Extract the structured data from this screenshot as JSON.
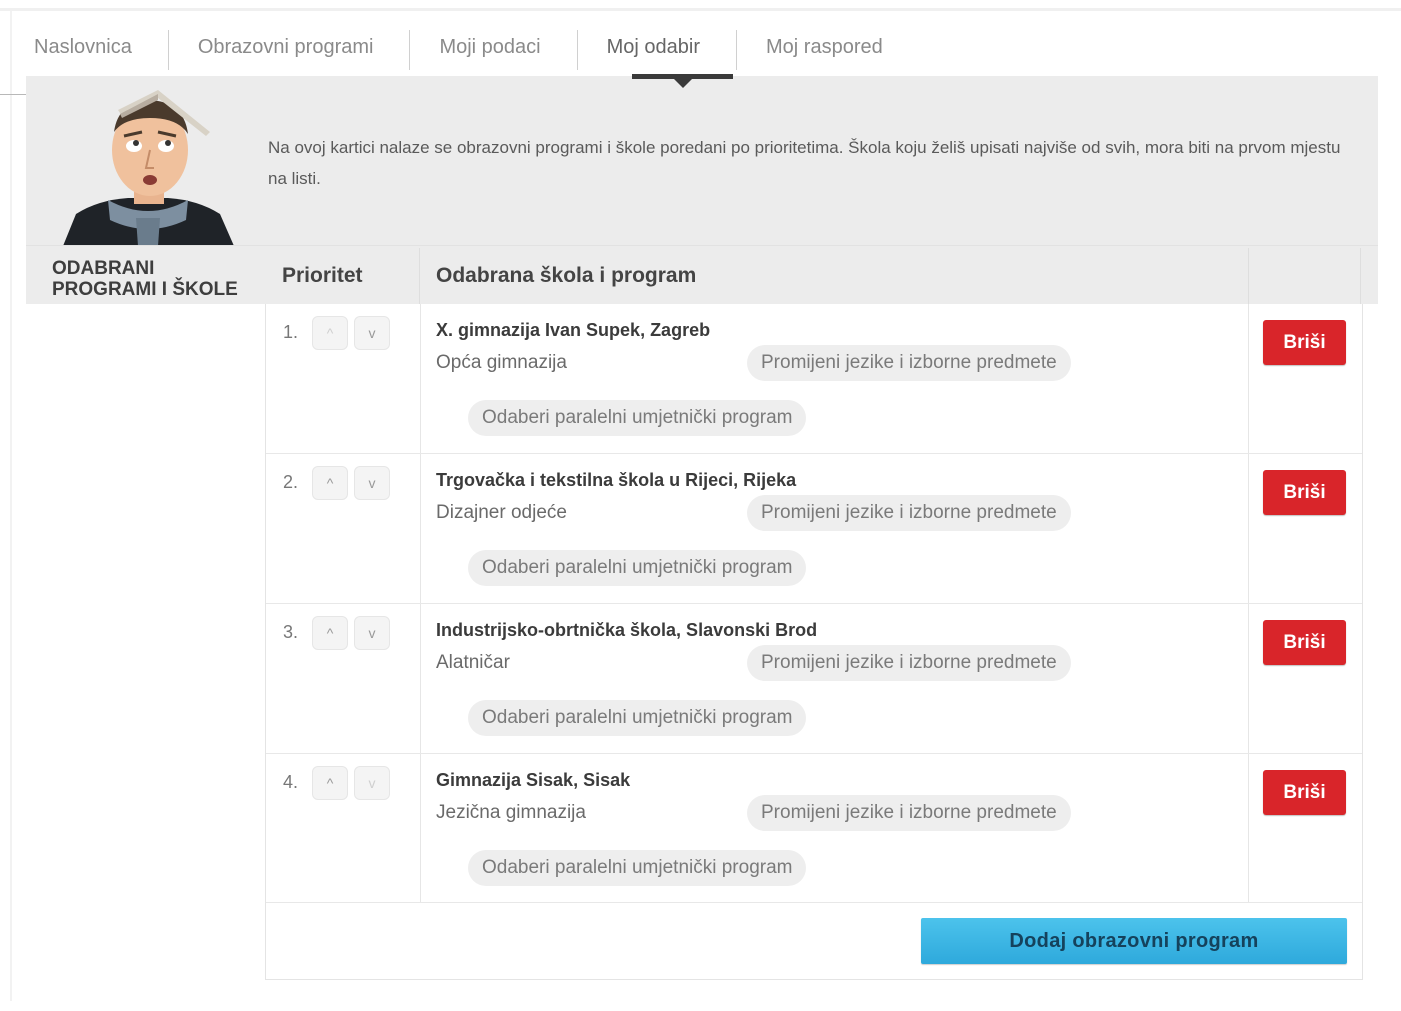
{
  "tabs": [
    {
      "label": "Naslovnica"
    },
    {
      "label": "Obrazovni programi"
    },
    {
      "label": "Moji podaci"
    },
    {
      "label": "Moj odabir"
    },
    {
      "label": "Moj raspored"
    }
  ],
  "active_tab": "Moj odabir",
  "intro_text": "Na ovoj kartici nalaze se obrazovni programi i škole poredani po prioritetima. Škola koju želiš upisati najviše od svih, mora biti na prvom mjestu na listi.",
  "section_title": "ODABRANI PROGRAMI I ŠKOLE",
  "table": {
    "header_priority": "Prioritet",
    "header_program": "Odabrana škola i program",
    "rows": [
      {
        "priority": "1.",
        "school": "X. gimnazija Ivan Supek, Zagreb",
        "program": "Opća gimnazija",
        "lang_button": "Promijeni jezike i izborne predmete",
        "art_button": "Odaberi paralelni umjetnički program",
        "delete_label": "Briši"
      },
      {
        "priority": "2.",
        "school": "Trgovačka i tekstilna škola u Rijeci, Rijeka",
        "program": "Dizajner odjeće",
        "lang_button": "Promijeni jezike i izborne predmete",
        "art_button": "Odaberi paralelni umjetnički program",
        "delete_label": "Briši"
      },
      {
        "priority": "3.",
        "school": "Industrijsko-obrtnička škola, Slavonski Brod",
        "program": "Alatničar",
        "lang_button": "Promijeni jezike i izborne predmete",
        "art_button": "Odaberi paralelni umjetnički program",
        "delete_label": "Briši"
      },
      {
        "priority": "4.",
        "school": "Gimnazija Sisak, Sisak",
        "program": "Jezična gimnazija",
        "lang_button": "Promijeni jezike i izborne predmete",
        "art_button": "Odaberi paralelni umjetnički program",
        "delete_label": "Briši"
      }
    ],
    "add_button": "Dodaj obrazovni program"
  },
  "icons": {
    "move_up": "chevron-up-icon",
    "move_down": "chevron-down-icon",
    "up_glyph": "^",
    "down_glyph": "v"
  },
  "colors": {
    "delete_button": "#d9252a",
    "add_button": "#2ea9dc",
    "panel_background": "#ececec",
    "active_tab_indicator": "#3a3a3a"
  }
}
